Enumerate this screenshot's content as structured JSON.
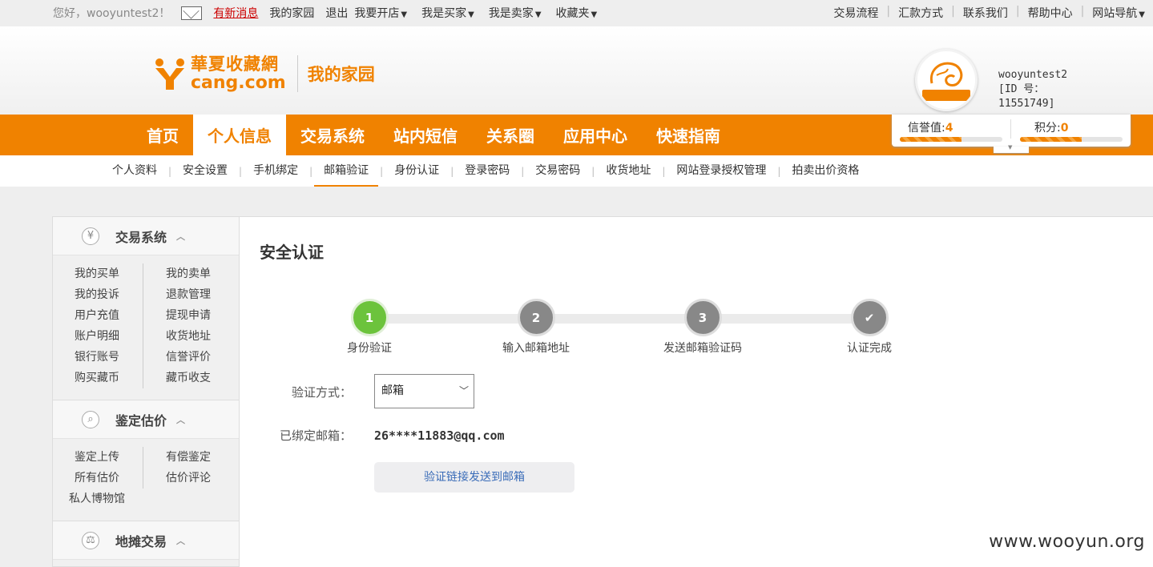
{
  "topbar": {
    "greeting": "您好，wooyuntest2！",
    "new_message": "有新消息",
    "links": [
      "我的家园",
      "退出"
    ],
    "menus": [
      "我要开店",
      "我是买家",
      "我是卖家",
      "收藏夹"
    ],
    "right_links": [
      "交易流程",
      "汇款方式",
      "联系我们",
      "帮助中心"
    ],
    "right_menu": "网站导航"
  },
  "header": {
    "logo_cn": "華夏收藏網",
    "logo_en": "cang.com",
    "section": "我的家园",
    "username": "wooyuntest2",
    "user_id": "[ID 号：11551749]"
  },
  "nav": {
    "items": [
      "首页",
      "个人信息",
      "交易系统",
      "站内短信",
      "关系圈",
      "应用中心",
      "快速指南"
    ],
    "active": "个人信息"
  },
  "credit": {
    "reputation_label": "信誉值:",
    "reputation_value": "4",
    "points_label": "积分:",
    "points_value": "0"
  },
  "subnav": {
    "items": [
      "个人资料",
      "安全设置",
      "手机绑定",
      "邮箱验证",
      "身份认证",
      "登录密码",
      "交易密码",
      "收货地址",
      "网站登录授权管理",
      "拍卖出价资格"
    ],
    "active": "邮箱验证"
  },
  "sidebar": {
    "sections": [
      {
        "title": "交易系统",
        "icon": "yen-icon",
        "glyph": "¥",
        "links": [
          "我的买单",
          "我的卖单",
          "我的投诉",
          "退款管理",
          "用户充值",
          "提现申请",
          "账户明细",
          "收货地址",
          "银行账号",
          "信誉评价",
          "购买藏币",
          "藏币收支"
        ],
        "extra": []
      },
      {
        "title": "鉴定估价",
        "icon": "magnifier-icon",
        "glyph": "⌕",
        "links": [
          "鉴定上传",
          "有偿鉴定",
          "所有估价",
          "估价评论"
        ],
        "extra": [
          "私人博物馆"
        ]
      },
      {
        "title": "地摊交易",
        "icon": "scale-icon",
        "glyph": "⚖",
        "links": [],
        "extra": []
      }
    ]
  },
  "main": {
    "title": "安全认证",
    "steps": [
      {
        "num": "1",
        "label": "身份验证",
        "state": "done"
      },
      {
        "num": "2",
        "label": "输入邮箱地址",
        "state": "todo"
      },
      {
        "num": "3",
        "label": "发送邮箱验证码",
        "state": "todo"
      },
      {
        "num": "✔",
        "label": "认证完成",
        "state": "todo"
      }
    ],
    "method_label": "验证方式：",
    "method_value": "邮箱",
    "email_label": "已绑定邮箱：",
    "email_value": "26****11883@qq.com",
    "send_button": "验证链接发送到邮箱"
  },
  "watermark": "www.wooyun.org",
  "colors": {
    "accent": "#f08200",
    "step_done": "#6cc33c",
    "step_todo": "#888888",
    "link": "#3a6cb8"
  }
}
